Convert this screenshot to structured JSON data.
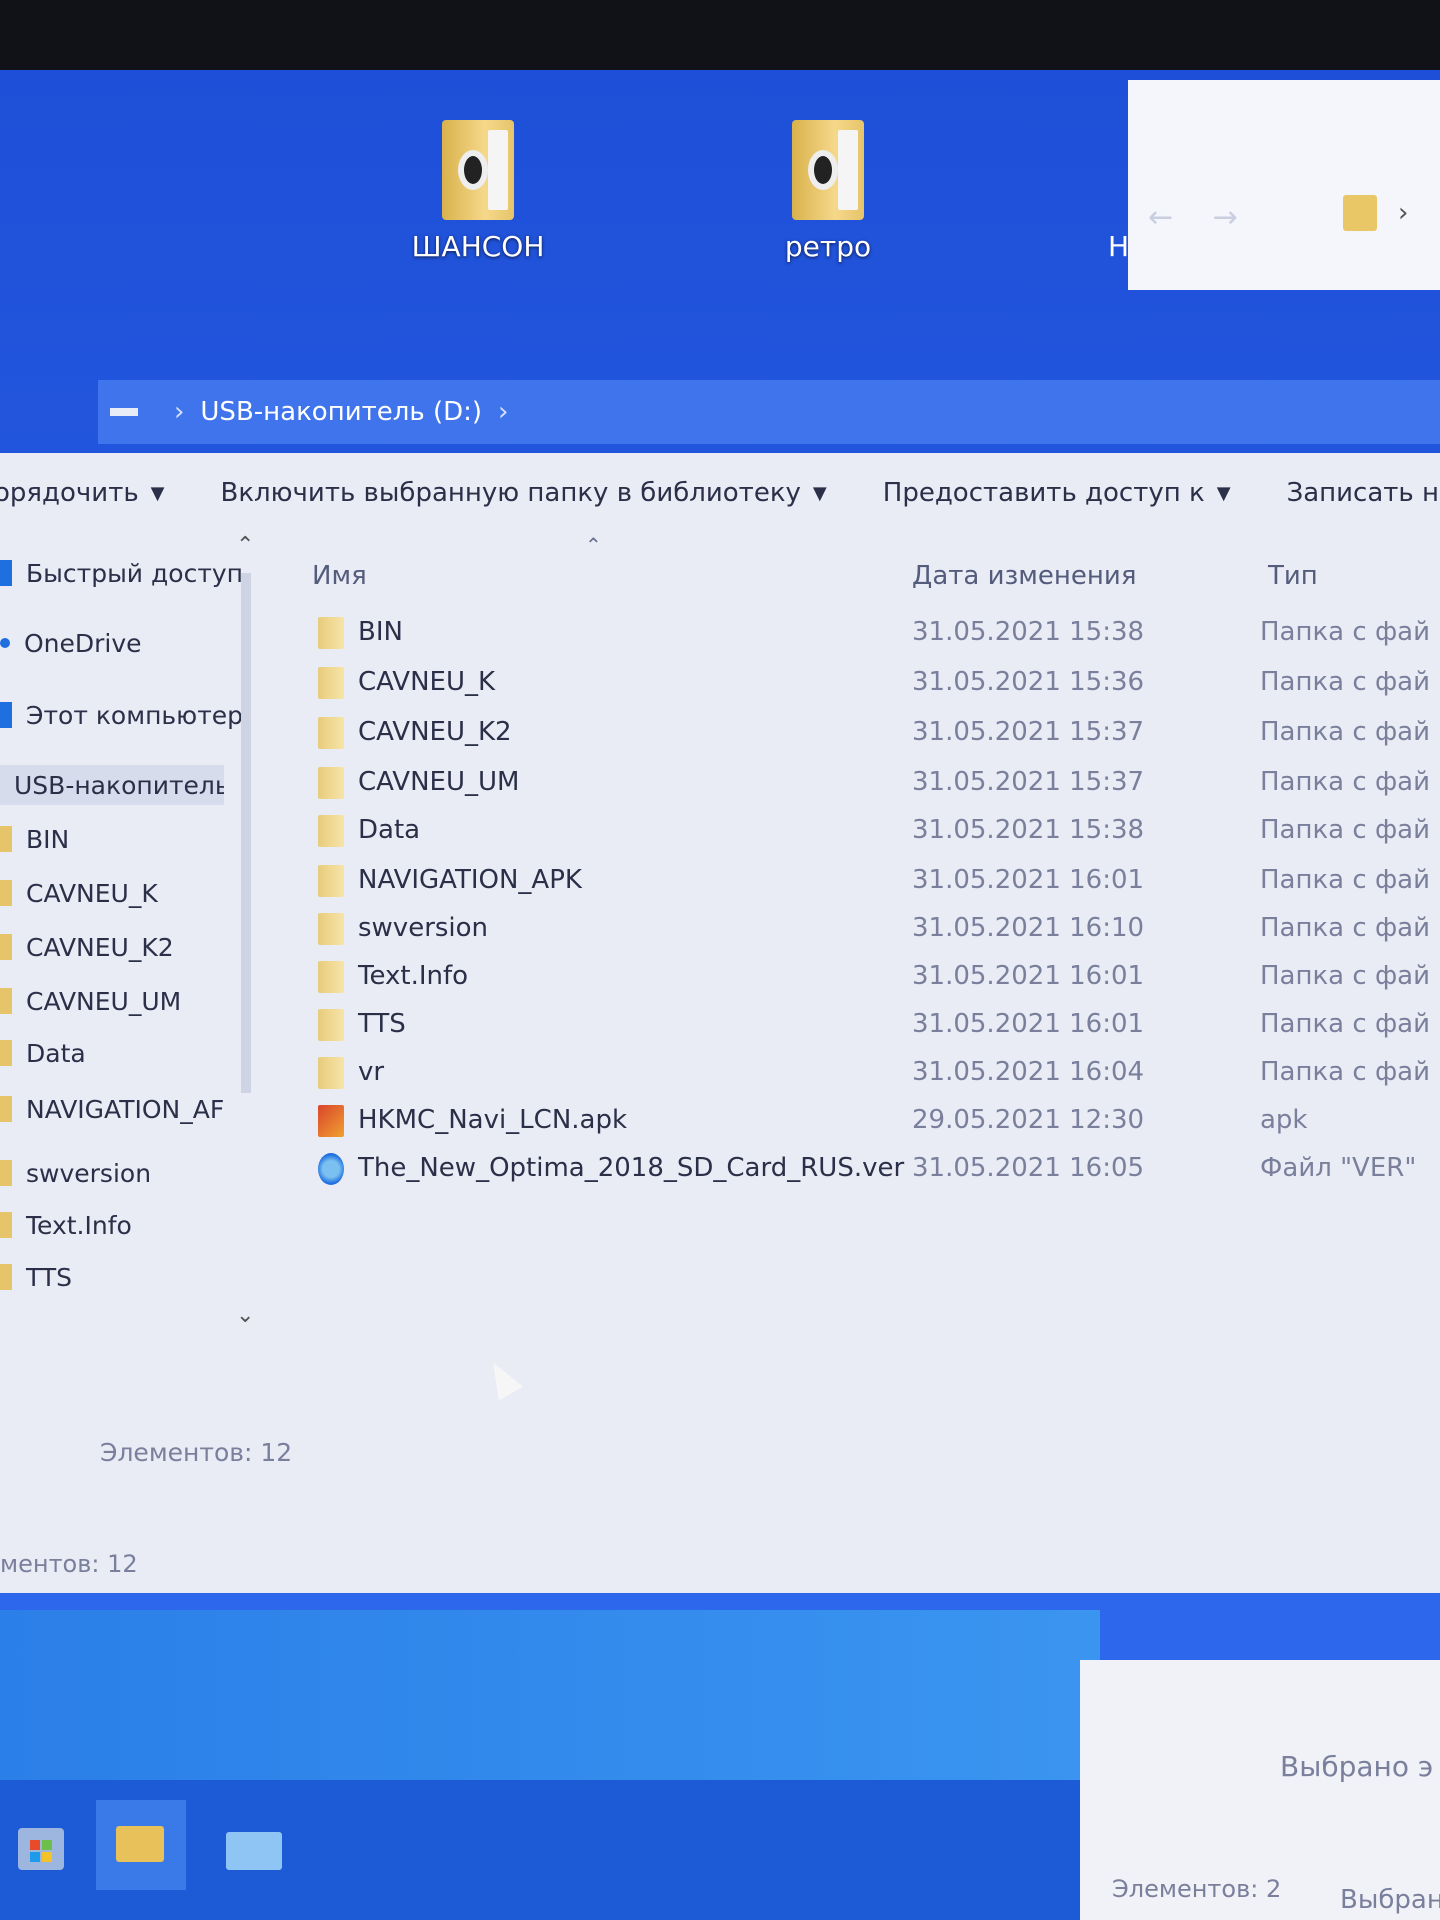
{
  "desktop": {
    "icons": [
      {
        "label": "ШАНСОН"
      },
      {
        "label": "ретро"
      }
    ],
    "edge_letter": "Н"
  },
  "window2": {
    "nav_back": "←",
    "nav_forward": "→",
    "nav_recent": "⌄",
    "bc_chevron": "›"
  },
  "address": {
    "path": "USB-накопитель (D:)",
    "chevron": "›"
  },
  "toolbar": {
    "organize": "орядочить",
    "include_library": "Включить выбранную папку в библиотеку",
    "share_with": "Предоставить доступ к",
    "burn": "Записать на",
    "caret": "▼"
  },
  "navpane": {
    "items": [
      {
        "label": "Быстрый доступ",
        "icon": "star-icon"
      },
      {
        "label": "OneDrive",
        "icon": "cloud-icon"
      },
      {
        "label": "Этот компьютер",
        "icon": "computer-icon"
      },
      {
        "label": "USB-накопитель",
        "icon": "usb-drive-icon"
      },
      {
        "label": "BIN",
        "icon": "folder-icon"
      },
      {
        "label": "CAVNEU_K",
        "icon": "folder-icon"
      },
      {
        "label": "CAVNEU_K2",
        "icon": "folder-icon"
      },
      {
        "label": "CAVNEU_UM",
        "icon": "folder-icon"
      },
      {
        "label": "Data",
        "icon": "folder-icon"
      },
      {
        "label": "NAVIGATION_AF",
        "icon": "folder-icon"
      },
      {
        "label": "swversion",
        "icon": "folder-icon"
      },
      {
        "label": "Text.Info",
        "icon": "folder-icon"
      },
      {
        "label": "TTS",
        "icon": "folder-icon"
      }
    ],
    "scroll_up": "⌃",
    "scroll_down": "⌄"
  },
  "filelist": {
    "columns": {
      "name": "Имя",
      "date": "Дата изменения",
      "type": "Тип"
    },
    "sort_caret": "⌃",
    "rows": [
      {
        "name": "BIN",
        "date": "31.05.2021 15:38",
        "type": "Папка с фай",
        "kind": "folder"
      },
      {
        "name": "CAVNEU_K",
        "date": "31.05.2021 15:36",
        "type": "Папка с фай",
        "kind": "folder"
      },
      {
        "name": "CAVNEU_K2",
        "date": "31.05.2021 15:37",
        "type": "Папка с фай",
        "kind": "folder"
      },
      {
        "name": "CAVNEU_UM",
        "date": "31.05.2021 15:37",
        "type": "Папка с фай",
        "kind": "folder"
      },
      {
        "name": "Data",
        "date": "31.05.2021 15:38",
        "type": "Папка с фай",
        "kind": "folder"
      },
      {
        "name": "NAVIGATION_APK",
        "date": "31.05.2021 16:01",
        "type": "Папка с фай",
        "kind": "folder"
      },
      {
        "name": "swversion",
        "date": "31.05.2021 16:10",
        "type": "Папка с фай",
        "kind": "folder"
      },
      {
        "name": "Text.Info",
        "date": "31.05.2021 16:01",
        "type": "Папка с фай",
        "kind": "folder"
      },
      {
        "name": "TTS",
        "date": "31.05.2021 16:01",
        "type": "Папка с фай",
        "kind": "folder"
      },
      {
        "name": "vr",
        "date": "31.05.2021 16:04",
        "type": "Папка с фай",
        "kind": "folder"
      },
      {
        "name": "HKMC_Navi_LCN.apk",
        "date": "29.05.2021 12:30",
        "type": "apk",
        "kind": "apk"
      },
      {
        "name": "The_New_Optima_2018_SD_Card_RUS.ver",
        "date": "31.05.2021 16:05",
        "type": "Файл \"VER\"",
        "kind": "ver"
      }
    ]
  },
  "status": {
    "items_count": "Элементов: 12",
    "items_count_lower": "ментов: 12"
  },
  "window3": {
    "selected": "Выбрано э",
    "items": "Элементов: 2",
    "selected2": "Выбран"
  },
  "taskbar": {
    "apps": [
      "store-icon",
      "file-explorer-icon",
      "mail-icon"
    ]
  }
}
